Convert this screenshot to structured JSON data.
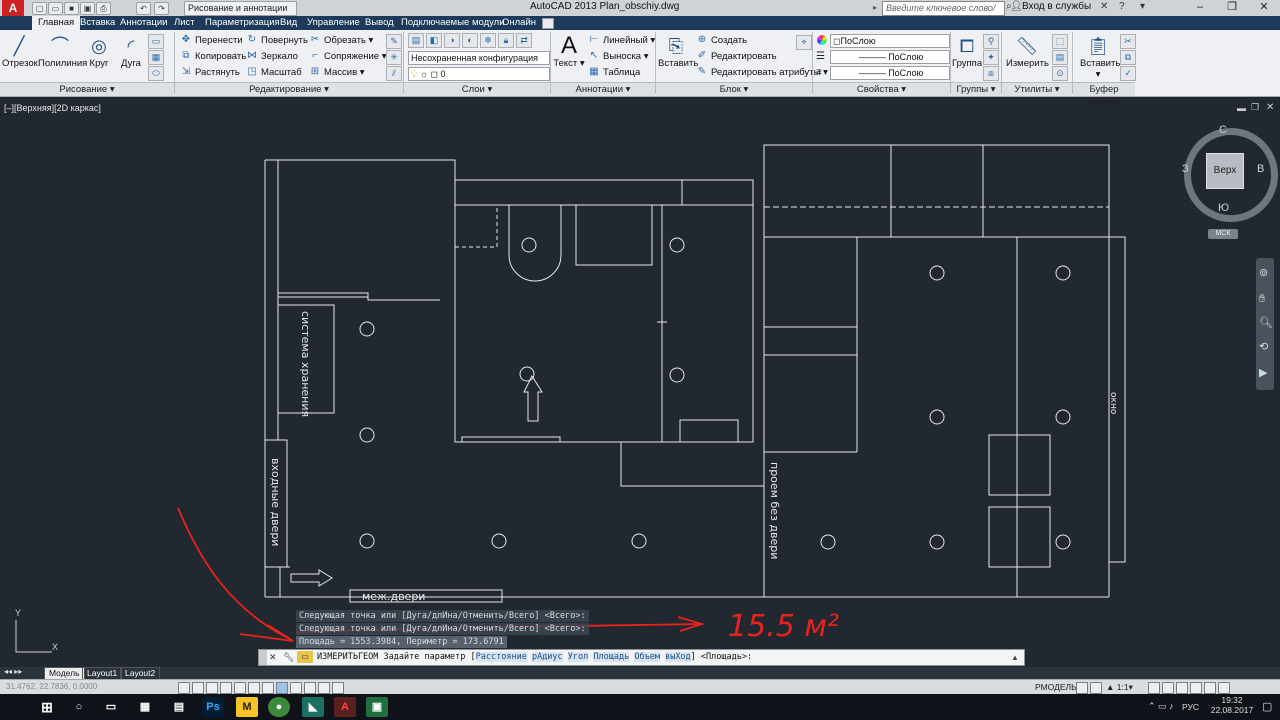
{
  "titlebar": {
    "workspace": "Рисование и аннотации",
    "app_title": "AutoCAD 2013    Plan_obschiy.dwg",
    "search_placeholder": "Введите ключевое слово/фразу",
    "signin": "Вход в службы"
  },
  "menus": [
    "Главная",
    "Вставка",
    "Аннотации",
    "Лист",
    "Параметризация",
    "Вид",
    "Управление",
    "Вывод",
    "Подключаемые модули",
    "Онлайн"
  ],
  "ribbon": {
    "draw": {
      "line": "Отрезок",
      "polyline": "Полилиния",
      "circle": "Круг",
      "arc": "Дуга",
      "panel": "Рисование"
    },
    "modify": {
      "move": "Перенести",
      "rotate": "Повернуть",
      "trim": "Обрезать",
      "copy": "Копировать",
      "mirror": "Зеркало",
      "fillet": "Сопряжение",
      "stretch": "Растянуть",
      "scale": "Масштаб",
      "array": "Массив",
      "panel": "Редактирование"
    },
    "layers": {
      "state": "Несохраненная конфигурация сло",
      "current": "0",
      "panel": "Слои"
    },
    "annotation": {
      "text": "Текст",
      "linear": "Линейный",
      "leader": "Выноска",
      "table": "Таблица",
      "panel": "Аннотации"
    },
    "block": {
      "insert": "Вставить",
      "create": "Создать",
      "edit": "Редактировать",
      "edit_attr": "Редактировать атрибуты",
      "panel": "Блок"
    },
    "properties": {
      "color": "ПоСлою",
      "linetype": "ПоСлою",
      "lineweight": "ПоСлою",
      "panel": "Свойства"
    },
    "groups": {
      "group": "Группа",
      "panel": "Группы"
    },
    "utilities": {
      "measure": "Измерить",
      "panel": "Утилиты"
    },
    "clipboard": {
      "paste": "Вставить",
      "panel": "Буфер обмена"
    }
  },
  "viewport": {
    "label": "[–][Верхняя][2D каркас]",
    "viewcube": {
      "north": "С",
      "south": "Ю",
      "east": "В",
      "west": "З",
      "top": "Верх",
      "ucs": "МСК"
    }
  },
  "drawing_labels": {
    "storage": "система хранения",
    "entry_door": "входные двери",
    "interior_doors": "меж.двери",
    "passage": "проем без двери",
    "window": "окно"
  },
  "command_history": [
    "Следующая точка или [Дуга/длИна/Отменить/Всего] <Всего>:",
    "Следующая точка или [Дуга/длИна/Отменить/Всего] <Всего>:",
    "Площадь = 1553.3984, Периметр = 173.6791"
  ],
  "command_line": {
    "prefix": "ИЗМЕРИТЬГЕОМ Задайте параметр [",
    "options": [
      "Расстояние",
      "рАдиус",
      "Угол",
      "Площадь",
      "Объем",
      "выХод"
    ],
    "suffix": "] <Площадь>:"
  },
  "annotation_text": "15.5 м²",
  "layout_tabs": [
    "Модель",
    "Layout1",
    "Layout2"
  ],
  "statusbar": {
    "coords": "31.4762, 22.7836, 0.0000",
    "model": "РМОДЕЛЬ",
    "scale": "1:1"
  },
  "taskbar": {
    "lang": "РУС",
    "time": "19:32",
    "date": "22.08.2017"
  },
  "colors": {
    "drawing_bg": "#212830",
    "ribbon_bg": "#eef0f3",
    "menu_bg": "#1d3a5a",
    "annotation": "#e8231e"
  }
}
